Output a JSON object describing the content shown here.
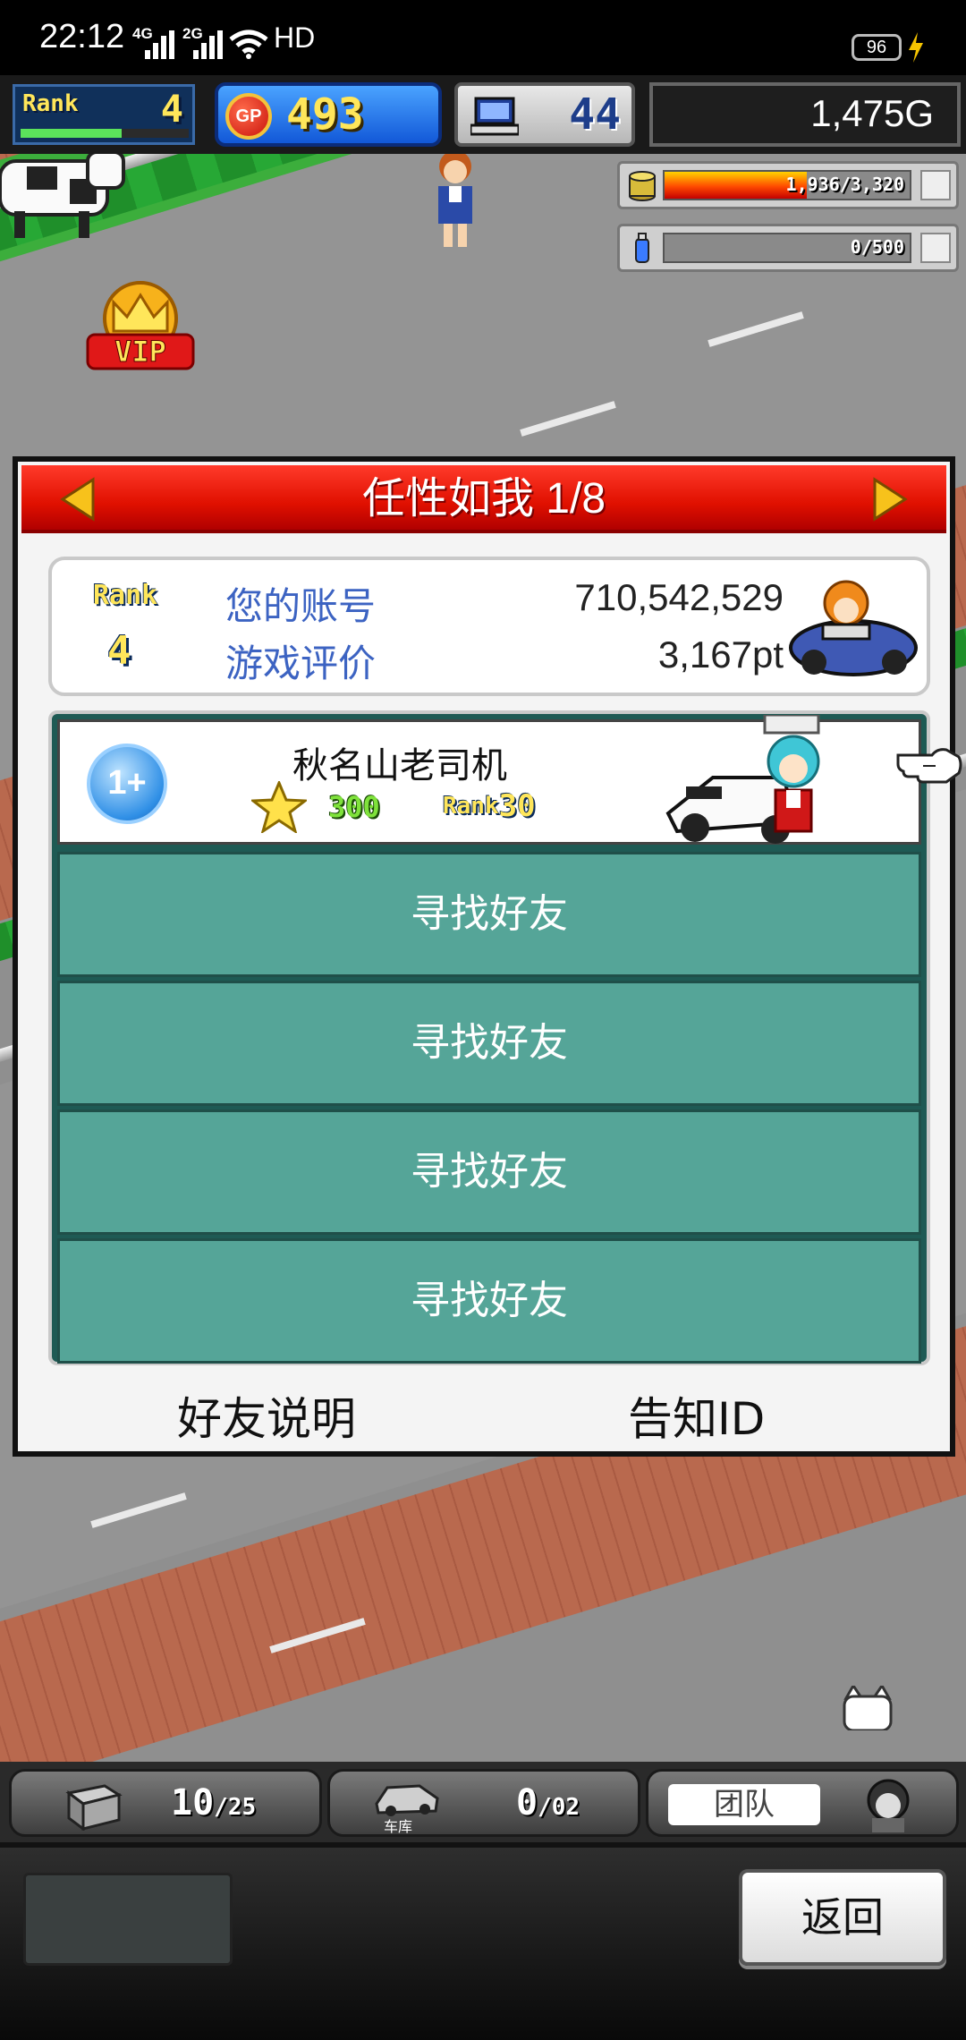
{
  "status_bar": {
    "time": "22:12",
    "network1": "4G",
    "network2": "2G",
    "hd": "HD",
    "battery": "96"
  },
  "hud": {
    "rank_word": "Rank",
    "rank": "4",
    "rank_progress": 0.6,
    "gp": "493",
    "pc": "44",
    "money": "1,475G",
    "resource1": "1,936/3,320",
    "resource1_fill": 0.58,
    "resource2": "0/500",
    "resource2_fill": 0,
    "vip": "VIP"
  },
  "panel": {
    "title": "任性如我 1/8",
    "rank_word": "Rank",
    "rank": "4",
    "account_label": "您的账号",
    "account_value": "710,542,529",
    "rating_label": "游戏评价",
    "rating_value": "3,167pt",
    "friend": {
      "badge": "1+",
      "name": "秋名山老司机",
      "count": "300",
      "rank_word": "Rank",
      "rank": "30"
    },
    "find_friends": [
      "寻找好友",
      "寻找好友",
      "寻找好友",
      "寻找好友"
    ],
    "friend_help": "好友说明",
    "notify_id": "告知ID"
  },
  "tray": {
    "slot1_value": "10",
    "slot1_total": "/25",
    "slot2_value": "0",
    "slot2_total": "/02",
    "garage_label": "车库",
    "team_label": "团队",
    "back": "返回"
  },
  "colors": {
    "title_red": "#e01000",
    "find_button": "#55a598",
    "account_label": "#3c63c2"
  }
}
